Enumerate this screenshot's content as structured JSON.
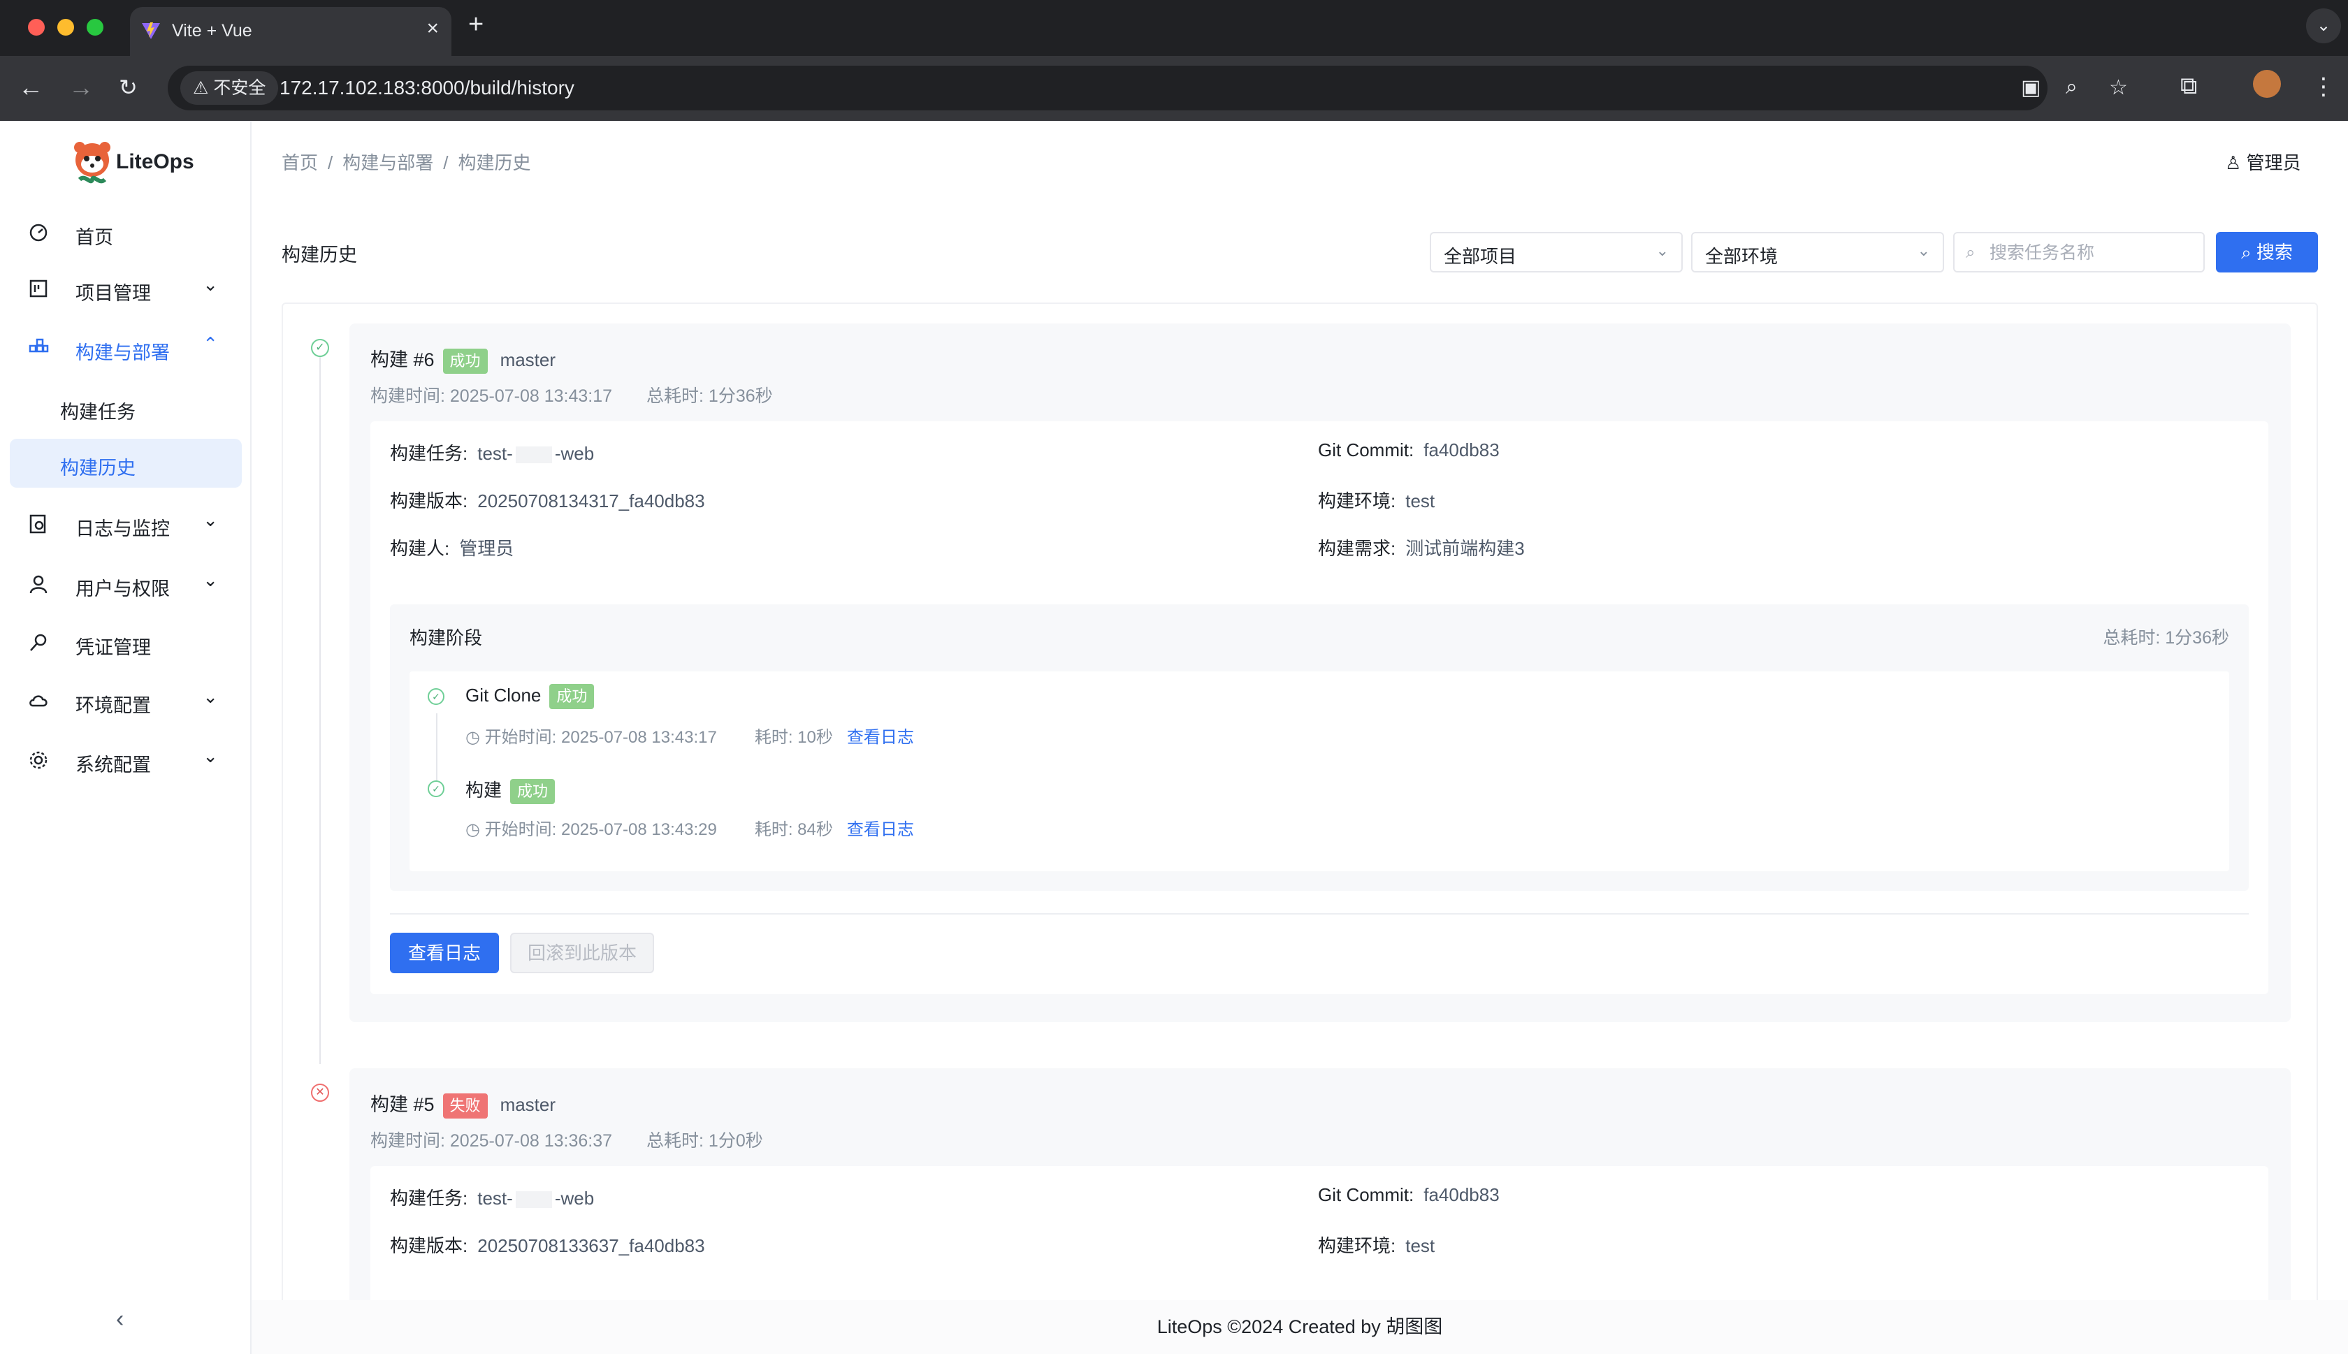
{
  "browser": {
    "tab_title": "Vite + Vue",
    "security_label": "不安全",
    "url": "172.17.102.183:8000/build/history"
  },
  "app": {
    "logo_text": "LiteOps",
    "user_name": "管理员"
  },
  "sidebar": {
    "items": [
      {
        "label": "首页",
        "icon": "dashboard-icon"
      },
      {
        "label": "项目管理",
        "icon": "project-icon"
      },
      {
        "label": "构建与部署",
        "icon": "build-icon"
      },
      {
        "label": "日志与监控",
        "icon": "log-icon"
      },
      {
        "label": "用户与权限",
        "icon": "user-icon"
      },
      {
        "label": "凭证管理",
        "icon": "key-icon"
      },
      {
        "label": "环境配置",
        "icon": "cloud-icon"
      },
      {
        "label": "系统配置",
        "icon": "gear-icon"
      }
    ],
    "sub_items": [
      "构建任务",
      "构建历史"
    ]
  },
  "breadcrumb": [
    "首页",
    "构建与部署",
    "构建历史"
  ],
  "page": {
    "title": "构建历史",
    "project_filter": "全部项目",
    "env_filter": "全部环境",
    "search_placeholder": "搜索任务名称",
    "search_button": "搜索"
  },
  "labels": {
    "task": "构建任务:",
    "version": "构建版本:",
    "builder": "构建人:",
    "commit": "Git Commit:",
    "env": "构建环境:",
    "requirement": "构建需求:",
    "build_time": "构建时间:",
    "total_time": "总耗时:",
    "stages_title": "构建阶段",
    "start_time": "开始时间:",
    "elapsed": "耗时:",
    "view_log": "查看日志",
    "rollback": "回滚到此版本"
  },
  "builds": [
    {
      "title": "构建 #6",
      "status": "成功",
      "branch": "master",
      "build_time": "2025-07-08 13:43:17",
      "total_time": "1分36秒",
      "task_prefix": "test-",
      "task_suffix": "-web",
      "version": "20250708134317_fa40db83",
      "builder": "管理员",
      "commit": "fa40db83",
      "env": "test",
      "requirement": "测试前端构建3",
      "stages_total": "1分36秒",
      "stages": [
        {
          "name": "Git Clone",
          "status": "成功",
          "start": "2025-07-08 13:43:17",
          "elapsed": "10秒"
        },
        {
          "name": "构建",
          "status": "成功",
          "start": "2025-07-08 13:43:29",
          "elapsed": "84秒"
        }
      ]
    },
    {
      "title": "构建 #5",
      "status": "失败",
      "branch": "master",
      "build_time": "2025-07-08 13:36:37",
      "total_time": "1分0秒",
      "task_prefix": "test-",
      "task_suffix": "-web",
      "version": "20250708133637_fa40db83",
      "commit": "fa40db83",
      "env": "test"
    }
  ],
  "footer": "LiteOps ©2024 Created by 胡图图"
}
